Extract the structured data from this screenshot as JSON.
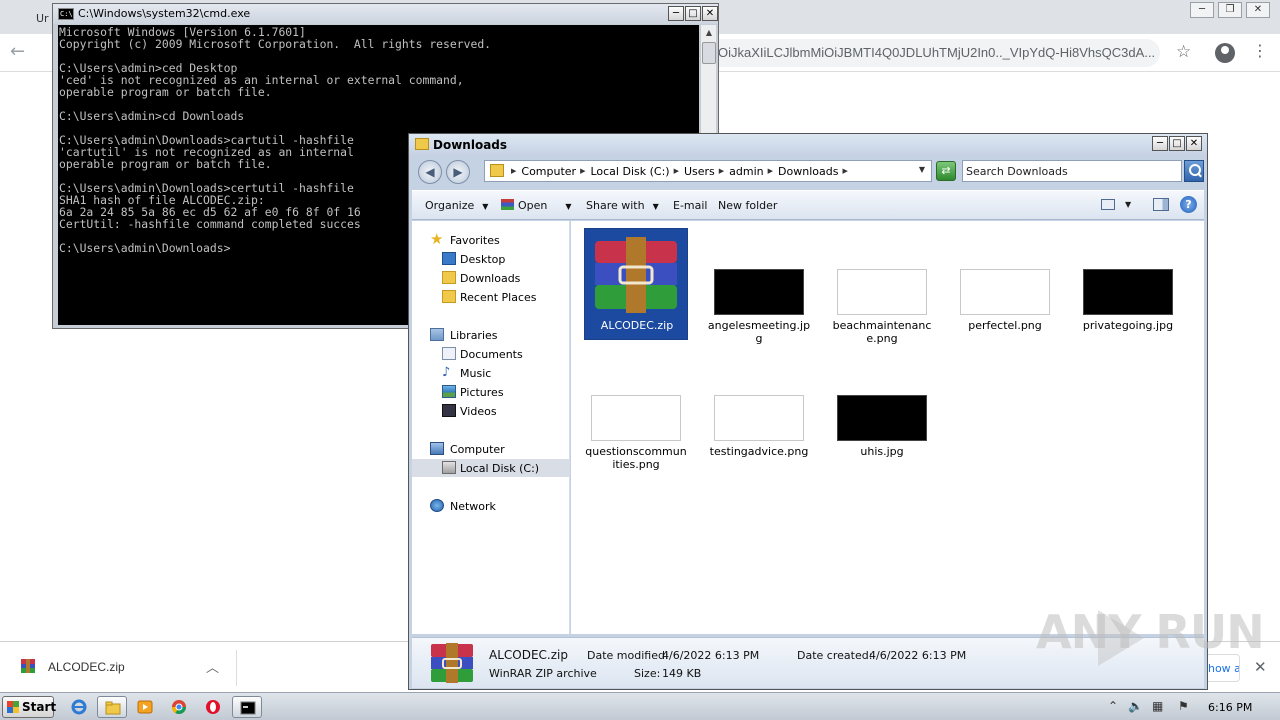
{
  "chrome": {
    "tab_title": "Ur",
    "url": "OiJkaXIiLCJlbmMiOiJBMTI4Q0JDLUhTMjU2In0.._VIpYdQ-Hi8VhsQC3dA...",
    "download_item": "ALCODEC.zip",
    "show_all": "Show all"
  },
  "cmd": {
    "title": "C:\\Windows\\system32\\cmd.exe",
    "icon_text": "C:\\",
    "lines": [
      "Microsoft Windows [Version 6.1.7601]",
      "Copyright (c) 2009 Microsoft Corporation.  All rights reserved.",
      "",
      "C:\\Users\\admin>ced Desktop",
      "'ced' is not recognized as an internal or external command,",
      "operable program or batch file.",
      "",
      "C:\\Users\\admin>cd Downloads",
      "",
      "C:\\Users\\admin\\Downloads>cartutil -hashfile",
      "'cartutil' is not recognized as an internal",
      "operable program or batch file.",
      "",
      "C:\\Users\\admin\\Downloads>certutil -hashfile",
      "SHA1 hash of file ALCODEC.zip:",
      "6a 2a 24 85 5a 86 ec d5 62 af e0 f6 8f 0f 16",
      "CertUtil: -hashfile command completed succes",
      "",
      "C:\\Users\\admin\\Downloads>"
    ]
  },
  "explorer": {
    "title": "Downloads",
    "breadcrumb": [
      "Computer",
      "Local Disk (C:)",
      "Users",
      "admin",
      "Downloads"
    ],
    "search_placeholder": "Search Downloads",
    "toolbar": {
      "organize": "Organize",
      "open": "Open",
      "share_with": "Share with",
      "email": "E-mail",
      "new_folder": "New folder"
    },
    "nav": {
      "favorites": "Favorites",
      "desktop": "Desktop",
      "downloads": "Downloads",
      "recent_places": "Recent Places",
      "libraries": "Libraries",
      "documents": "Documents",
      "music": "Music",
      "pictures": "Pictures",
      "videos": "Videos",
      "computer": "Computer",
      "local_disk": "Local Disk (C:)",
      "network": "Network"
    },
    "files": [
      {
        "name": "ALCODEC.zip",
        "thumb": "rar",
        "selected": true
      },
      {
        "name": "angelesmeeting.jpg",
        "thumb": "dark"
      },
      {
        "name": "beachmaintenance.png",
        "thumb": "light"
      },
      {
        "name": "perfectel.png",
        "thumb": "light"
      },
      {
        "name": "privategoing.jpg",
        "thumb": "dark"
      },
      {
        "name": "questionscommunities.png",
        "thumb": "light"
      },
      {
        "name": "testingadvice.png",
        "thumb": "light"
      },
      {
        "name": "uhis.jpg",
        "thumb": "dark"
      }
    ],
    "details": {
      "name": "ALCODEC.zip",
      "type": "WinRAR ZIP archive",
      "date_modified_label": "Date modified:",
      "date_modified": "4/6/2022 6:13 PM",
      "size_label": "Size:",
      "size": "149 KB",
      "date_created_label": "Date created:",
      "date_created": "4/6/2022 6:13 PM"
    }
  },
  "watermark": "ANY RUN",
  "taskbar": {
    "start": "Start",
    "clock": "6:16 PM"
  },
  "colors": {
    "selection": "#1b4aa0",
    "cmd_bg": "#000000",
    "cmd_fg": "#c0c0c0",
    "explorer_frame": "#c5d2e3"
  }
}
